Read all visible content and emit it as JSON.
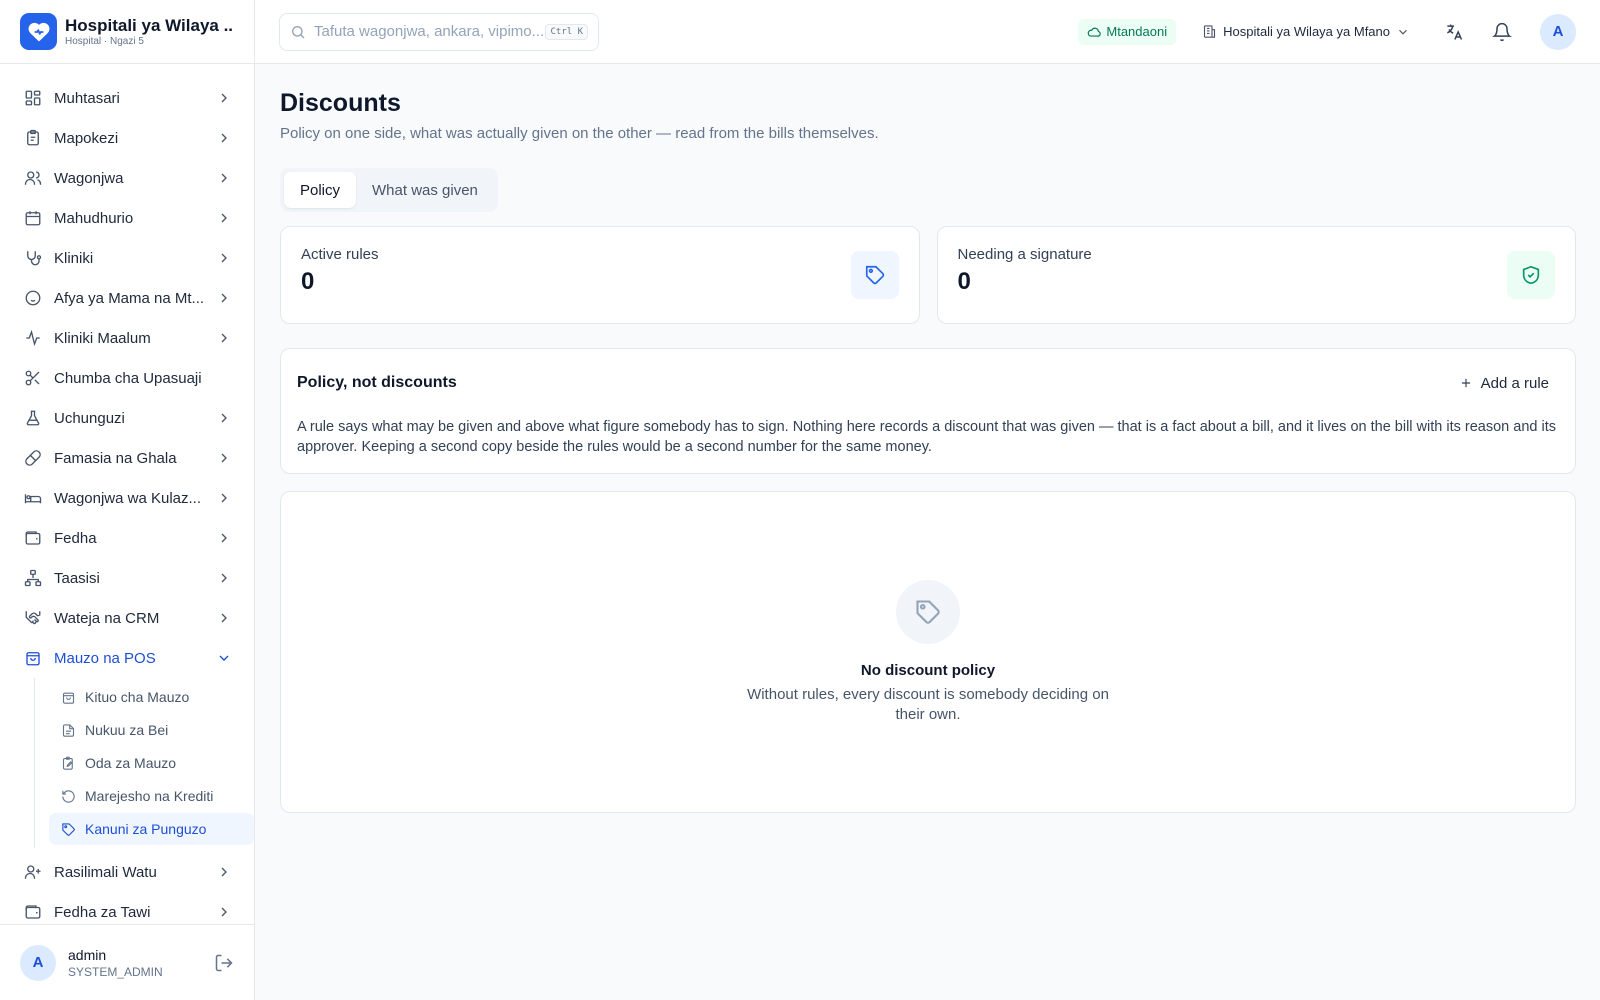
{
  "brand": {
    "name": "Hospitali ya Wilaya ...",
    "subtitle": "Hospital · Ngazi 5"
  },
  "nav": {
    "items": [
      {
        "label": "Muhtasari",
        "icon": "dashboard-icon"
      },
      {
        "label": "Mapokezi",
        "icon": "clipboard-icon"
      },
      {
        "label": "Wagonjwa",
        "icon": "users-icon"
      },
      {
        "label": "Mahudhurio",
        "icon": "calendar-icon"
      },
      {
        "label": "Kliniki",
        "icon": "stethoscope-icon"
      },
      {
        "label": "Afya ya Mama na Mt...",
        "icon": "baby-icon"
      },
      {
        "label": "Kliniki Maalum",
        "icon": "activity-icon"
      },
      {
        "label": "Chumba cha Upasuaji",
        "icon": "scissors-icon"
      },
      {
        "label": "Uchunguzi",
        "icon": "flask-icon"
      },
      {
        "label": "Famasia na Ghala",
        "icon": "pill-icon"
      },
      {
        "label": "Wagonjwa wa Kulaz...",
        "icon": "bed-icon"
      },
      {
        "label": "Fedha",
        "icon": "wallet-icon"
      },
      {
        "label": "Taasisi",
        "icon": "org-chart-icon"
      },
      {
        "label": "Wateja na CRM",
        "icon": "handshake-icon"
      },
      {
        "label": "Mauzo na POS",
        "icon": "shopping-bag-icon"
      }
    ],
    "sub_items": [
      {
        "label": "Kituo cha Mauzo",
        "icon": "shopping-bag-icon"
      },
      {
        "label": "Nukuu za Bei",
        "icon": "file-text-icon"
      },
      {
        "label": "Oda za Mauzo",
        "icon": "edit-note-icon"
      },
      {
        "label": "Marejesho na Krediti",
        "icon": "rotate-ccw-icon"
      },
      {
        "label": "Kanuni za Punguzo",
        "icon": "tag-icon"
      }
    ],
    "bottom_items": [
      {
        "label": "Rasilimali Watu",
        "icon": "user-icon"
      },
      {
        "label": "Fedha za Tawi",
        "icon": "wallet-icon"
      }
    ]
  },
  "user": {
    "initial": "A",
    "name": "admin",
    "role": "SYSTEM_ADMIN"
  },
  "header": {
    "search_placeholder": "Tafuta wagonjwa, ankara, vipimo...",
    "search_shortcut": "Ctrl K",
    "status": "Mtandaoni",
    "facility": "Hospitali ya Wilaya ya Mfano",
    "avatar_initial": "A"
  },
  "page": {
    "title": "Discounts",
    "subtitle": "Policy on one side, what was actually given on the other — read from the bills themselves.",
    "tabs": [
      "Policy",
      "What was given"
    ],
    "active_tab": "Policy"
  },
  "stats": [
    {
      "label": "Active rules",
      "value": "0",
      "icon": "tag-icon",
      "color": "#2563eb",
      "bg": "#eff6ff"
    },
    {
      "label": "Needing a signature",
      "value": "0",
      "icon": "shield-check-icon",
      "color": "#059669",
      "bg": "#ecfdf5"
    }
  ],
  "policy": {
    "title": "Policy, not discounts",
    "add_label": "Add a rule",
    "body": "A rule says what may be given and above what figure somebody has to sign. Nothing here records a discount that was given — that is a fact about a bill, and it lives on the bill with its reason and its approver. Keeping a second copy beside the rules would be a second number for the same money."
  },
  "empty": {
    "title": "No discount policy",
    "description": "Without rules, every discount is somebody deciding on their own."
  },
  "colors": {
    "accent": "#2563eb",
    "accent_text": "#1d4ed8",
    "success": "#047857"
  }
}
